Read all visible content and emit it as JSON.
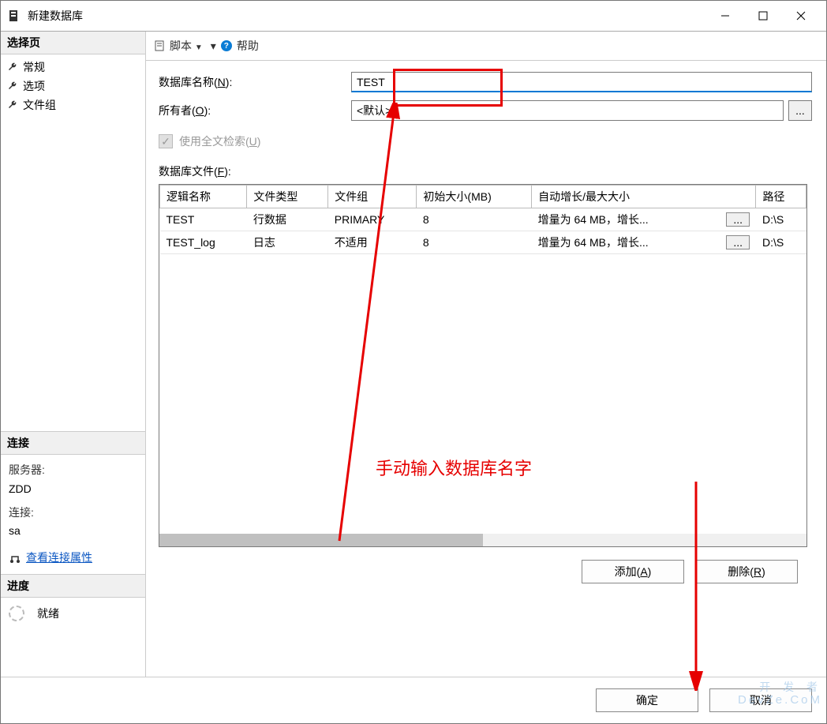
{
  "window": {
    "title": "新建数据库"
  },
  "sidebar": {
    "select_page_header": "选择页",
    "items": [
      {
        "label": "常规"
      },
      {
        "label": "选项"
      },
      {
        "label": "文件组"
      }
    ],
    "connection_header": "连接",
    "server_label": "服务器:",
    "server_value": "ZDD",
    "conn_label": "连接:",
    "conn_value": "sa",
    "view_props_link": "查看连接属性",
    "progress_header": "进度",
    "progress_status": "就绪"
  },
  "toolbar": {
    "script_label": "脚本",
    "help_label": "帮助"
  },
  "form": {
    "dbname_label": "数据库名称(N):",
    "dbname_value": "TEST",
    "owner_label": "所有者(O):",
    "owner_value": "<默认>",
    "owner_browse": "...",
    "fulltext_label": "使用全文检索(U)",
    "files_label": "数据库文件(F):"
  },
  "table": {
    "headers": {
      "logical_name": "逻辑名称",
      "file_type": "文件类型",
      "filegroup": "文件组",
      "init_size": "初始大小(MB)",
      "autogrowth": "自动增长/最大大小",
      "path": "路径"
    },
    "rows": [
      {
        "logical_name": "TEST",
        "file_type": "行数据",
        "filegroup": "PRIMARY",
        "init_size": "8",
        "autogrowth": "增量为 64 MB，增长...",
        "browse": "...",
        "path": "D:\\S"
      },
      {
        "logical_name": "TEST_log",
        "file_type": "日志",
        "filegroup": "不适用",
        "init_size": "8",
        "autogrowth": "增量为 64 MB，增长...",
        "browse": "...",
        "path": "D:\\S"
      }
    ]
  },
  "buttons": {
    "add": "添加(A)",
    "remove": "删除(R)",
    "ok": "确定",
    "cancel": "取消"
  },
  "annotation": {
    "text": "手动输入数据库名字"
  },
  "watermark": {
    "line1": "开 发 者",
    "line2": "DevZe.CoM"
  }
}
